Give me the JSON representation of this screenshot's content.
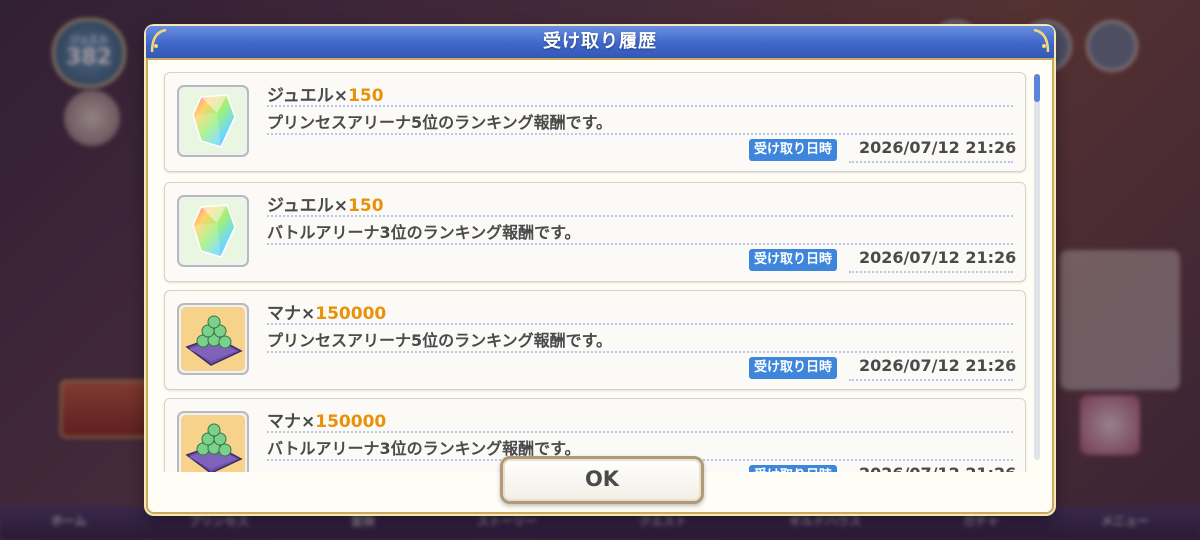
{
  "background": {
    "counter_label": "ジュエル",
    "counter_value": "382",
    "nav_labels": [
      "ホーム",
      "プリンセス",
      "冒険",
      "ストーリー",
      "クエスト",
      "ギルドハウス",
      "ガチャ",
      "メニュー"
    ]
  },
  "modal": {
    "title": "受け取り履歴",
    "ok_label": "OK",
    "date_badge_label": "受け取り日時"
  },
  "entries": [
    {
      "item": "ジュエル×",
      "qty": "150",
      "desc": "プリンセスアリーナ5位のランキング報酬です。",
      "date": "2026/07/12 21:26",
      "icon": "jewel-icon"
    },
    {
      "item": "ジュエル×",
      "qty": "150",
      "desc": "バトルアリーナ3位のランキング報酬です。",
      "date": "2026/07/12 21:26",
      "icon": "jewel-icon"
    },
    {
      "item": "マナ×",
      "qty": "150000",
      "desc": "プリンセスアリーナ5位のランキング報酬です。",
      "date": "2026/07/12 21:26",
      "icon": "mana-icon"
    },
    {
      "item": "マナ×",
      "qty": "150000",
      "desc": "バトルアリーナ3位のランキング報酬です。",
      "date": "2026/07/12 21:26",
      "icon": "mana-icon"
    }
  ],
  "scroll_position": 0.0
}
